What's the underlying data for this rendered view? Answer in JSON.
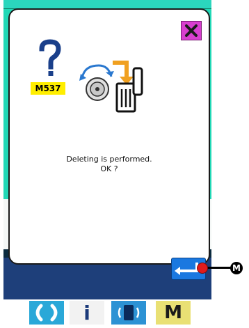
{
  "dialog": {
    "message_code": "M537",
    "message_lines": [
      "Deleting is performed.",
      "OK ?"
    ]
  },
  "callout": {
    "label": "M"
  },
  "toolbar": {
    "info_label": "i",
    "mode_label": "M"
  },
  "icons": {
    "close": "close-icon",
    "help": "question-mark-icon",
    "trash": "trash-can-icon",
    "enter": "enter-icon",
    "reset": "reset-icon",
    "info": "info-icon",
    "communication": "communication-icon",
    "mode": "mode-icon"
  },
  "colors": {
    "close_button": "#d93fd0",
    "message_code_badge": "#ffee00",
    "enter_button": "#1a78e0",
    "callout_dot": "#e01b1b"
  }
}
